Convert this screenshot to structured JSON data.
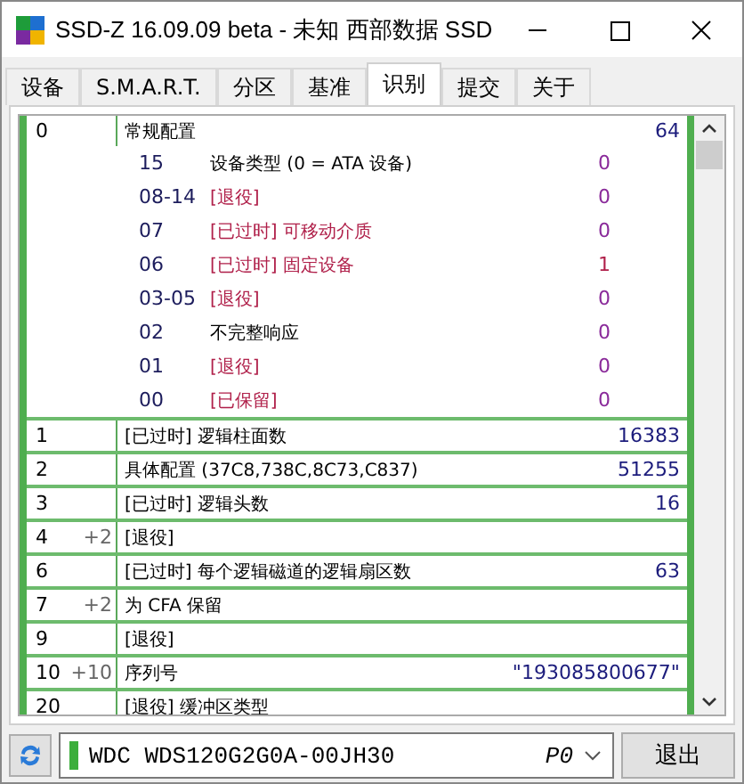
{
  "window": {
    "title": "SSD-Z 16.09.09 beta - 未知 西部数据 SSD"
  },
  "tabs": [
    {
      "label": "设备",
      "selected": false
    },
    {
      "label": "S.M.A.R.T.",
      "selected": false
    },
    {
      "label": "分区",
      "selected": false
    },
    {
      "label": "基准",
      "selected": false
    },
    {
      "label": "识别",
      "selected": true
    },
    {
      "label": "提交",
      "selected": false
    },
    {
      "label": "关于",
      "selected": false
    }
  ],
  "rows": [
    {
      "word": "0",
      "label": "常规配置",
      "value": "64",
      "bits": [
        {
          "bit": "15",
          "label": "设备类型 (0 = ATA 设备)",
          "value": "0",
          "kind": "normal"
        },
        {
          "bit": "08-14",
          "label": "[退役]",
          "value": "0",
          "kind": "retired"
        },
        {
          "bit": "07",
          "label": "[已过时] 可移动介质",
          "value": "0",
          "kind": "retired"
        },
        {
          "bit": "06",
          "label": "[已过时] 固定设备",
          "value": "1",
          "kind": "retired"
        },
        {
          "bit": "03-05",
          "label": "[退役]",
          "value": "0",
          "kind": "retired"
        },
        {
          "bit": "02",
          "label": "不完整响应",
          "value": "0",
          "kind": "normal"
        },
        {
          "bit": "01",
          "label": "[退役]",
          "value": "0",
          "kind": "retired"
        },
        {
          "bit": "00",
          "label": "[已保留]",
          "value": "0",
          "kind": "retired"
        }
      ]
    },
    {
      "word": "1",
      "label": "[已过时] 逻辑柱面数",
      "value": "16383"
    },
    {
      "word": "2",
      "label": "具体配置 (37C8,738C,8C73,C837)",
      "value": "51255"
    },
    {
      "word": "3",
      "label": "[已过时] 逻辑头数",
      "value": "16"
    },
    {
      "word": "4",
      "span": "+2",
      "label": "[退役]"
    },
    {
      "word": "6",
      "label": "[已过时] 每个逻辑磁道的逻辑扇区数",
      "value": "63"
    },
    {
      "word": "7",
      "span": "+2",
      "label": "为 CFA 保留"
    },
    {
      "word": "9",
      "label": "[退役]"
    },
    {
      "word": "10",
      "span": "+10",
      "label": "序列号",
      "value": "\"193085800677\""
    },
    {
      "word": "20",
      "label": "[退役] 缓冲区类型"
    }
  ],
  "drive": {
    "name": "WDC WDS120G2G0A-00JH30",
    "port": "P0"
  },
  "exit_button": "退出"
}
